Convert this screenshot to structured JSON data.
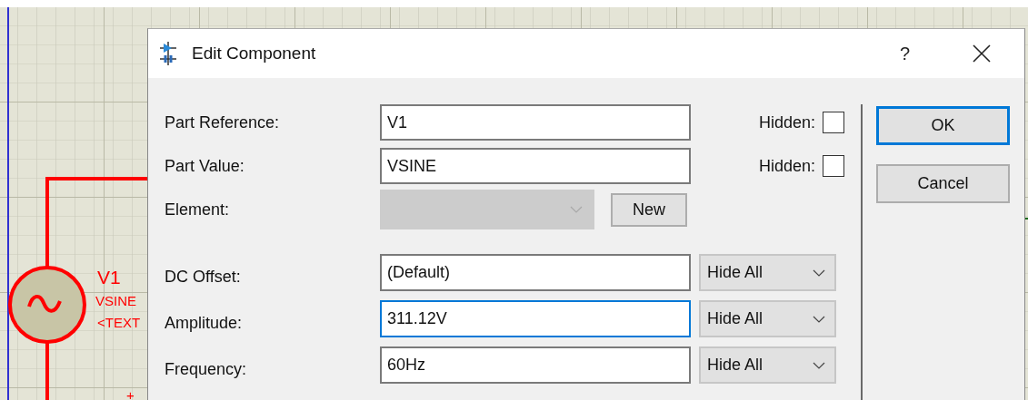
{
  "schematic": {
    "reference": "V1",
    "value": "VSINE",
    "text": "<TEXT",
    "pin_mark": "+"
  },
  "dialog": {
    "title": "Edit Component",
    "help": "?",
    "fields": [
      {
        "kind": "text",
        "label": "Part Reference:",
        "value": "V1",
        "hidden_label": "Hidden:",
        "hidden": false
      },
      {
        "kind": "text",
        "label": "Part Value:",
        "value": "VSINE",
        "hidden_label": "Hidden:",
        "hidden": false
      },
      {
        "kind": "select",
        "label": "Element:",
        "disabled": true,
        "button": "New"
      }
    ],
    "properties": [
      {
        "label": "DC Offset:",
        "value": "(Default)",
        "visibility": "Hide All",
        "focused": false
      },
      {
        "label": "Amplitude:",
        "value": "311.12V",
        "visibility": "Hide All",
        "focused": true
      },
      {
        "label": "Frequency:",
        "value": "60Hz",
        "visibility": "Hide All",
        "focused": false
      }
    ],
    "buttons": [
      {
        "label": "OK",
        "default": true
      },
      {
        "label": "Cancel",
        "default": false
      }
    ]
  }
}
